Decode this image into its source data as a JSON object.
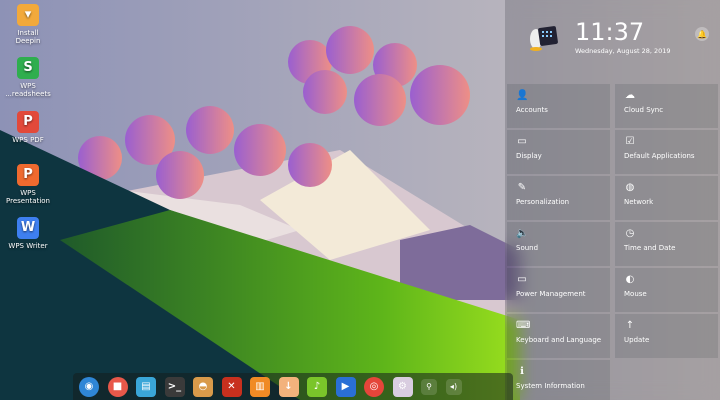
{
  "desktop": {
    "icons": [
      {
        "label": "Install Deepin",
        "icon": "install-deepin-icon",
        "color": "#f2a93b"
      },
      {
        "label": "WPS ...readsheets",
        "icon": "spreadsheet-icon",
        "color": "#2fae4e",
        "glyph": "S"
      },
      {
        "label": "WPS PDF",
        "icon": "pdf-icon",
        "color": "#e2493a",
        "glyph": "P"
      },
      {
        "label": "WPS Presentation",
        "icon": "presentation-icon",
        "color": "#ef6a2f",
        "glyph": "P"
      },
      {
        "label": "WPS Writer",
        "icon": "writer-icon",
        "color": "#3e7ff0",
        "glyph": "W"
      }
    ]
  },
  "panel": {
    "time": "11:37",
    "date": "Wednesday, August 28, 2019",
    "notification_glyph": "🔔",
    "settings": [
      {
        "label": "Accounts",
        "glyph": "👤"
      },
      {
        "label": "Cloud Sync",
        "glyph": "☁"
      },
      {
        "label": "Display",
        "glyph": "▭"
      },
      {
        "label": "Default Applications",
        "glyph": "☑"
      },
      {
        "label": "Personalization",
        "glyph": "✎"
      },
      {
        "label": "Network",
        "glyph": "◍"
      },
      {
        "label": "Sound",
        "glyph": "🔈"
      },
      {
        "label": "Time and Date",
        "glyph": "◷"
      },
      {
        "label": "Power Management",
        "glyph": "▭"
      },
      {
        "label": "Mouse",
        "glyph": "◐"
      },
      {
        "label": "Keyboard and Language",
        "glyph": "⌨"
      },
      {
        "label": "Update",
        "glyph": "↑"
      },
      {
        "label": "System Information",
        "glyph": "ℹ"
      }
    ]
  },
  "dock": {
    "apps": [
      {
        "name": "launcher",
        "color": "#2f86d6",
        "glyph": "◉"
      },
      {
        "name": "screen-recorder",
        "color": "#e8584a",
        "glyph": "■"
      },
      {
        "name": "file-manager",
        "color": "#3aa6d8",
        "glyph": "▤"
      },
      {
        "name": "terminal",
        "color": "#3a3a3a",
        "glyph": ">_"
      },
      {
        "name": "installer",
        "color": "#d99a4a",
        "glyph": "◓"
      },
      {
        "name": "crossover",
        "color": "#c8301e",
        "glyph": "✕"
      },
      {
        "name": "app-store",
        "color": "#f08a25",
        "glyph": "▥"
      },
      {
        "name": "downloader",
        "color": "#f3b27c",
        "glyph": "↓"
      },
      {
        "name": "music",
        "color": "#7ac52a",
        "glyph": "♪"
      },
      {
        "name": "video",
        "color": "#2a6fd6",
        "glyph": "▶"
      },
      {
        "name": "chrome",
        "color": "#e5453a",
        "glyph": "◎"
      },
      {
        "name": "settings",
        "color": "#d9cde0",
        "glyph": "⚙"
      }
    ],
    "tray": [
      {
        "name": "usb",
        "glyph": "⚲"
      },
      {
        "name": "volume",
        "glyph": "◂)"
      }
    ]
  }
}
